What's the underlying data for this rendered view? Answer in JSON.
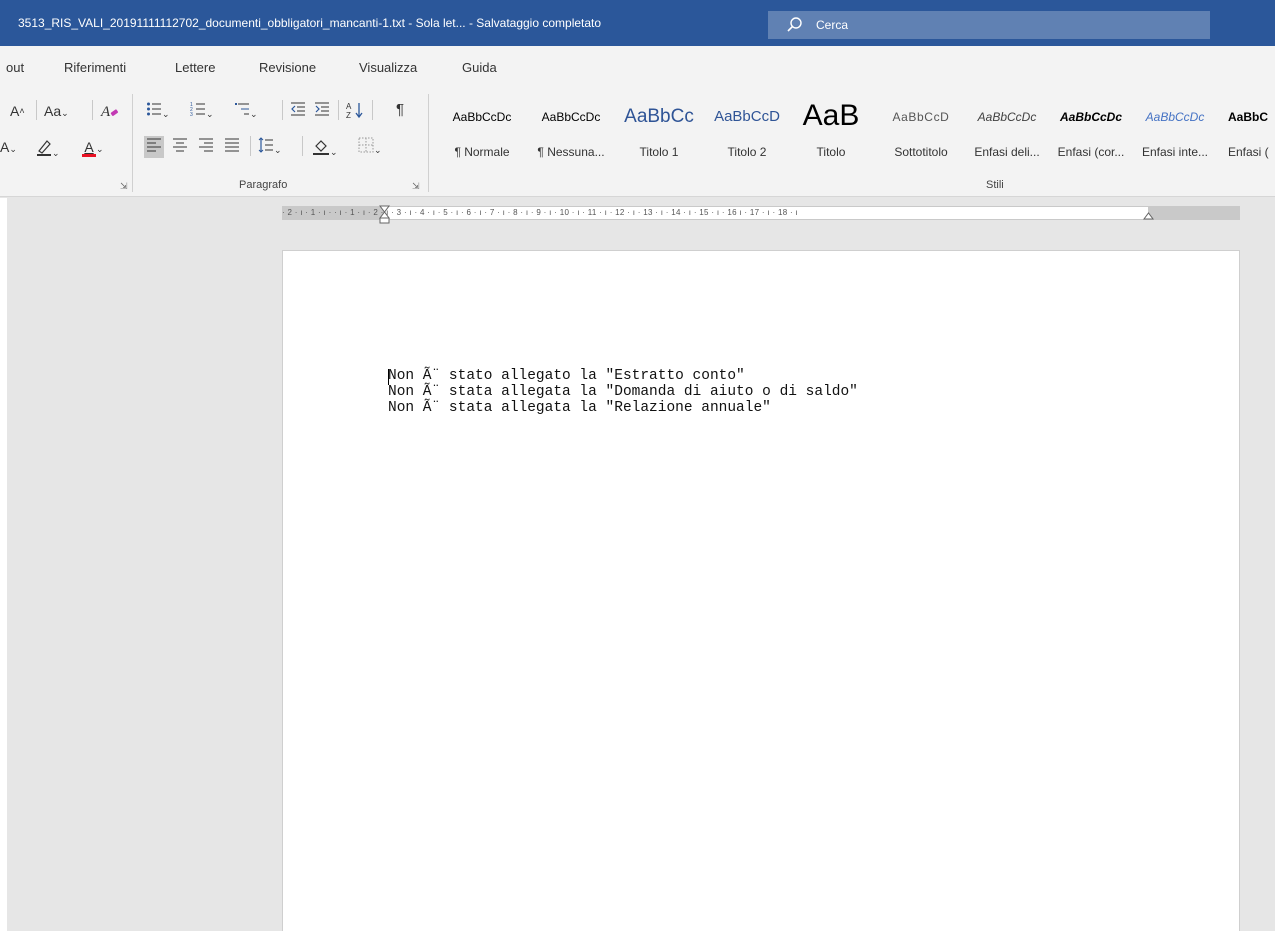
{
  "window": {
    "title": "3513_RIS_VALI_20191111112702_documenti_obbligatori_mancanti-1.txt  -  Sola let...  -  Salvataggio completato",
    "search_label": "Cerca"
  },
  "tabs": [
    "out",
    "Riferimenti",
    "Lettere",
    "Revisione",
    "Visualizza",
    "Guida"
  ],
  "font_group": {
    "row1": [
      "A˘",
      "Aa⌄",
      "A̷"
    ],
    "row2": [
      "A⌄",
      "🖉⌄",
      "A⌄"
    ]
  },
  "paragraph_group": {
    "label": "Paragrafo"
  },
  "styles_group": {
    "label": "Stili",
    "items": [
      {
        "preview": "AaBbCcDc",
        "name": "¶ Normale"
      },
      {
        "preview": "AaBbCcDc",
        "name": "¶ Nessuna..."
      },
      {
        "preview": "AaBbCc",
        "name": "Titolo 1"
      },
      {
        "preview": "AaBbCcD",
        "name": "Titolo 2"
      },
      {
        "preview": "AaB",
        "name": "Titolo"
      },
      {
        "preview": "AaBbCcD",
        "name": "Sottotitolo"
      },
      {
        "preview": "AaBbCcDc",
        "name": "Enfasi deli..."
      },
      {
        "preview": "AaBbCcDc",
        "name": "Enfasi (cor..."
      },
      {
        "preview": "AaBbCcDc",
        "name": "Enfasi inte..."
      },
      {
        "preview": "AaBbC",
        "name": "Enfasi ("
      }
    ]
  },
  "ruler": {
    "text": "· 2 · ı · 1 · ı ·       · ı · 1 · ı · 2 · ı · 3 · ı · 4 · ı · 5 · ı · 6 · ı · 7 · ı · 8 · ı · 9 · ı · 10 · ı · 11 · ı · 12 · ı · 13 · ı · 14 · ı · 15 · ı · 16       ı · 17 · ı · 18 · ı"
  },
  "document": {
    "lines": [
      "Non Ã¨ stato allegato la \"Estratto conto\"",
      "Non Ã¨ stata allegata la \"Domanda di aiuto o di saldo\"",
      "Non Ã¨ stata allegata la \"Relazione annuale\""
    ]
  },
  "colors": {
    "title_bar": "#2b579a",
    "ribbon_bg": "#f3f3f3",
    "workspace": "#e6e6e6",
    "heading_blue": "#2f5496",
    "font_color_red": "#e81123"
  }
}
